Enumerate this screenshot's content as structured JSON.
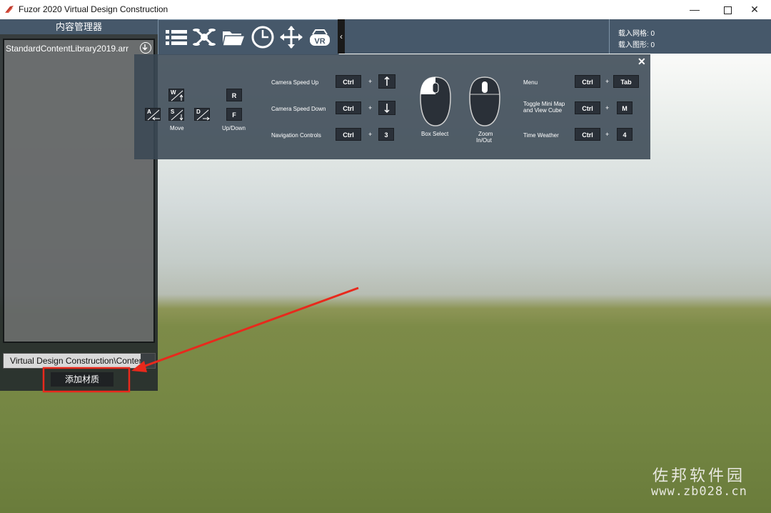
{
  "window": {
    "title": "Fuzor 2020 Virtual Design Construction",
    "minimize": "—",
    "close": "✕"
  },
  "content_manager": {
    "title": "内容管理器",
    "library_file": "StandardContentLibrary2019.arr",
    "path": "Virtual Design Construction\\Content\\",
    "add_material_label": "添加材质"
  },
  "toolbar": {
    "icons": [
      "list-icon",
      "drone-icon",
      "folder-icon",
      "clock-icon",
      "move-arrows-icon",
      "vr-headset-icon"
    ],
    "vr_text": "VR",
    "collapse": "‹"
  },
  "stats": {
    "meshes": "载入网格: 0",
    "shapes": "载入图形: 0"
  },
  "help": {
    "close": "✕",
    "move_label": "Move",
    "updown_label": "Up/Down",
    "keys": {
      "w": "W",
      "a": "A",
      "s": "S",
      "d": "D",
      "r": "R",
      "f": "F",
      "ctrl": "Ctrl",
      "plus": "+",
      "three": "3",
      "tab": "Tab",
      "m": "M",
      "four": "4"
    },
    "camera_speed_up": "Camera Speed Up",
    "camera_speed_down": "Camera Speed Down",
    "navigation_controls": "Navigation Controls",
    "box_select": "Box Select",
    "zoom": "Zoom",
    "in_out": "In/Out",
    "menu": "Menu",
    "toggle_line1": "Toggle Mini Map",
    "toggle_line2": "and View Cube",
    "time_weather": "Time Weather"
  },
  "watermark": {
    "cn": "佐邦软件园",
    "url": "www.zb028.cn"
  },
  "colors": {
    "panel_header": "#46586a",
    "annotation": "#e8291c"
  }
}
